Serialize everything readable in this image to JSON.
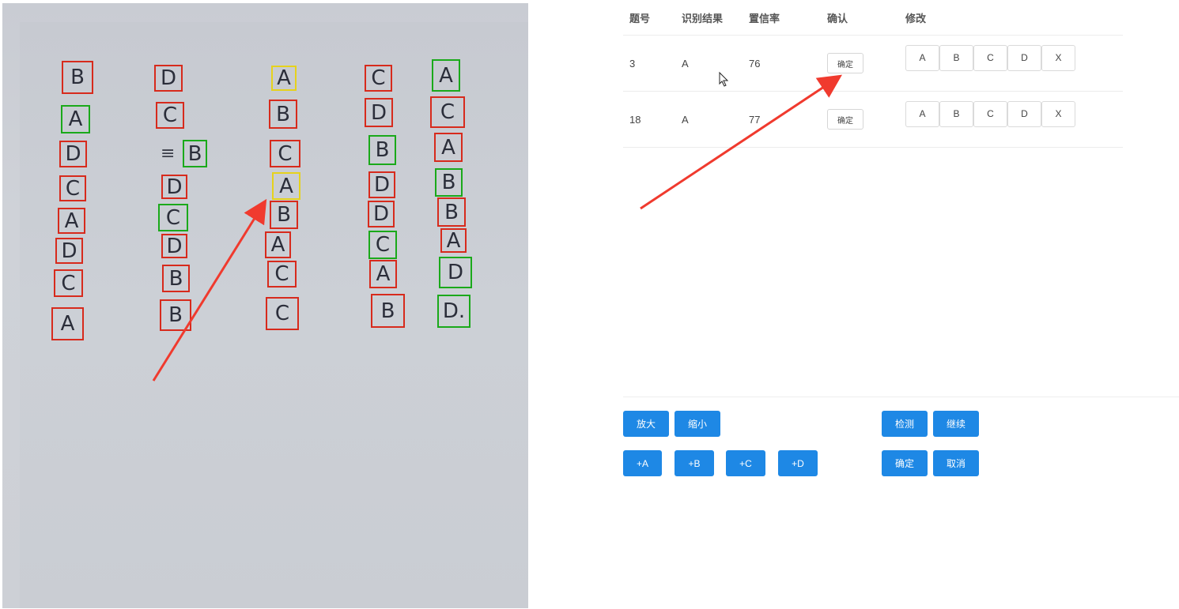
{
  "photo": {
    "answer_boxes": [
      {
        "letter": "B",
        "color": "red"
      },
      {
        "letter": "A",
        "color": "green"
      },
      {
        "letter": "D",
        "color": "red"
      },
      {
        "letter": "C",
        "color": "red"
      },
      {
        "letter": "A",
        "color": "red"
      },
      {
        "letter": "D",
        "color": "red"
      },
      {
        "letter": "C",
        "color": "red"
      },
      {
        "letter": "A",
        "color": "red"
      },
      {
        "letter": "D",
        "color": "red"
      },
      {
        "letter": "C",
        "color": "red"
      },
      {
        "letter": "B",
        "color": "green"
      },
      {
        "letter": "D",
        "color": "red"
      },
      {
        "letter": "C",
        "color": "green"
      },
      {
        "letter": "D",
        "color": "red"
      },
      {
        "letter": "B",
        "color": "red"
      },
      {
        "letter": "B",
        "color": "red"
      },
      {
        "letter": "A",
        "color": "yellow"
      },
      {
        "letter": "B",
        "color": "red"
      },
      {
        "letter": "C",
        "color": "red"
      },
      {
        "letter": "A",
        "color": "yellow"
      },
      {
        "letter": "B",
        "color": "red"
      },
      {
        "letter": "A",
        "color": "red"
      },
      {
        "letter": "C",
        "color": "red"
      },
      {
        "letter": "C",
        "color": "red"
      },
      {
        "letter": "C",
        "color": "red"
      },
      {
        "letter": "D",
        "color": "red"
      },
      {
        "letter": "B",
        "color": "green"
      },
      {
        "letter": "D",
        "color": "red"
      },
      {
        "letter": "D",
        "color": "red"
      },
      {
        "letter": "C",
        "color": "green"
      },
      {
        "letter": "A",
        "color": "red"
      },
      {
        "letter": "B",
        "color": "red"
      },
      {
        "letter": "A",
        "color": "green"
      },
      {
        "letter": "C",
        "color": "red"
      },
      {
        "letter": "A",
        "color": "red"
      },
      {
        "letter": "B",
        "color": "green"
      },
      {
        "letter": "B",
        "color": "red"
      },
      {
        "letter": "A",
        "color": "red"
      },
      {
        "letter": "D",
        "color": "green"
      },
      {
        "letter": "D.",
        "color": "green"
      }
    ],
    "scribble": "≡",
    "colors": {
      "red": "#d72a1c",
      "green": "#1aa91a",
      "yellow": "#e6d21c"
    }
  },
  "table": {
    "headers": [
      "题号",
      "识别结果",
      "置信率",
      "确认",
      "修改"
    ],
    "rows": [
      {
        "num": "3",
        "result": "A",
        "confidence": "76",
        "confirm": "确定"
      },
      {
        "num": "18",
        "result": "A",
        "confidence": "77",
        "confirm": "确定"
      }
    ],
    "options": [
      "A",
      "B",
      "C",
      "D",
      "X"
    ]
  },
  "controls": {
    "zoom_in": "放大",
    "zoom_out": "缩小",
    "detect": "检测",
    "continue": "继续",
    "add_a": "+A",
    "add_b": "+B",
    "add_c": "+C",
    "add_d": "+D",
    "confirm": "确定",
    "cancel": "取消"
  },
  "accent": "#1e88e5",
  "arrow_color": "#f03a2e"
}
